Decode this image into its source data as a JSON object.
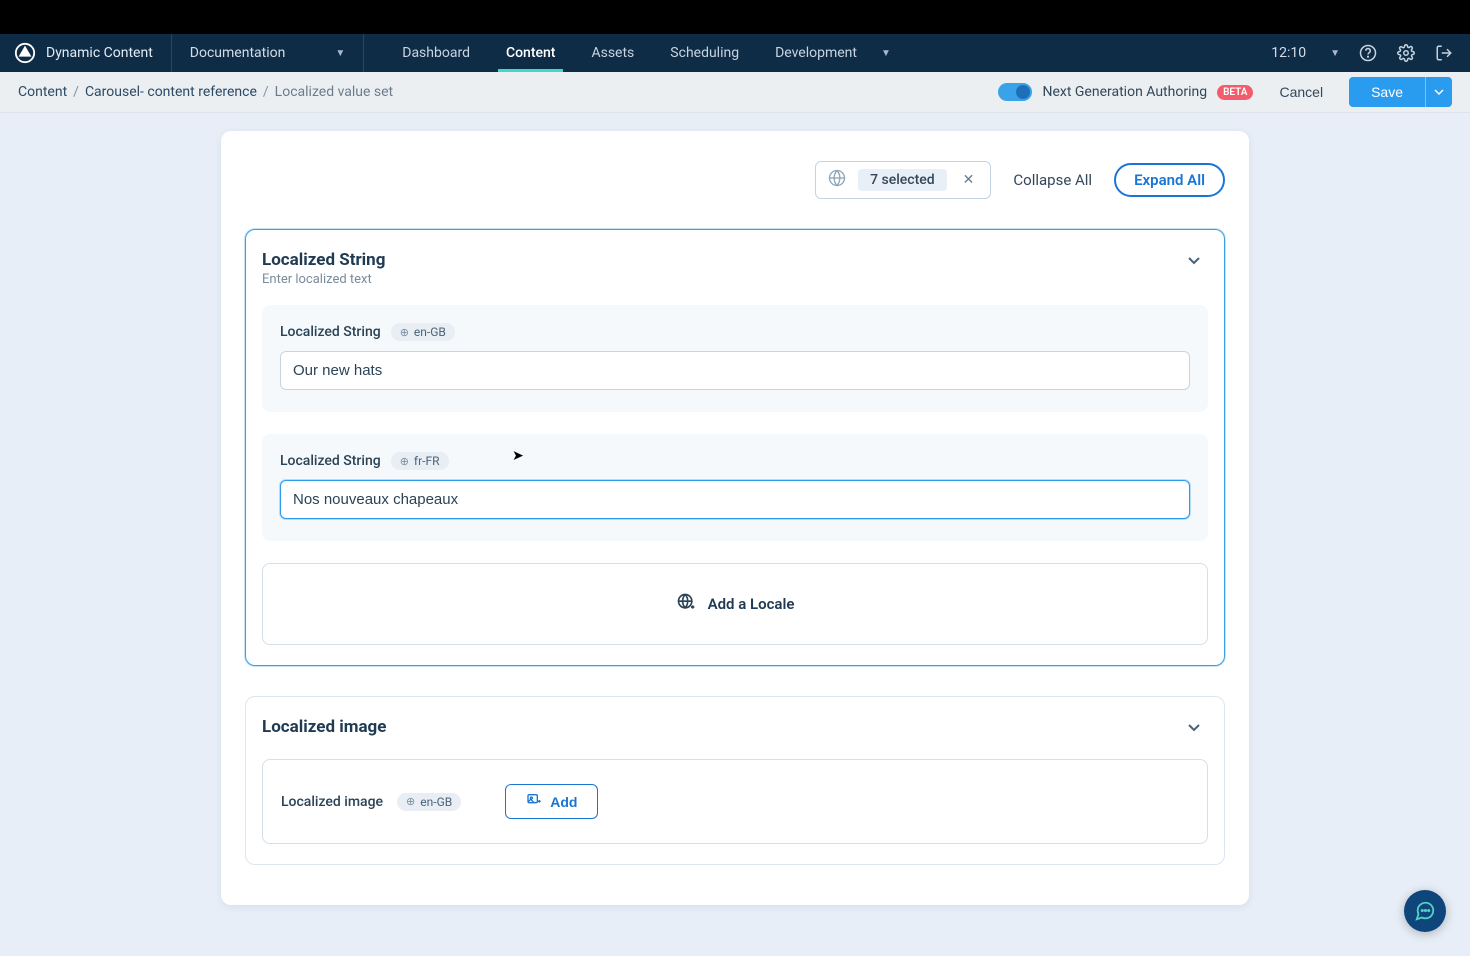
{
  "brand": "Dynamic Content",
  "hub": "Documentation",
  "nav": {
    "dashboard": "Dashboard",
    "content": "Content",
    "assets": "Assets",
    "scheduling": "Scheduling",
    "development": "Development"
  },
  "time": "12:10",
  "breadcrumb": {
    "root": "Content",
    "mid": "Carousel- content reference",
    "current": "Localized value set"
  },
  "nga": {
    "label": "Next Generation Authoring",
    "badge": "BETA"
  },
  "actions": {
    "cancel": "Cancel",
    "save": "Save"
  },
  "toolbar": {
    "selected": "7 selected",
    "collapse": "Collapse All",
    "expand": "Expand All"
  },
  "section1": {
    "title": "Localized String",
    "sub": "Enter localized text",
    "field_label": "Localized String",
    "locales": {
      "en": "en-GB",
      "fr": "fr-FR"
    },
    "values": {
      "en": "Our new hats",
      "fr": "Nos nouveaux chapeaux"
    },
    "add_locale": "Add a Locale"
  },
  "section2": {
    "title": "Localized image",
    "field_label": "Localized image",
    "locale": "en-GB",
    "add": "Add"
  }
}
